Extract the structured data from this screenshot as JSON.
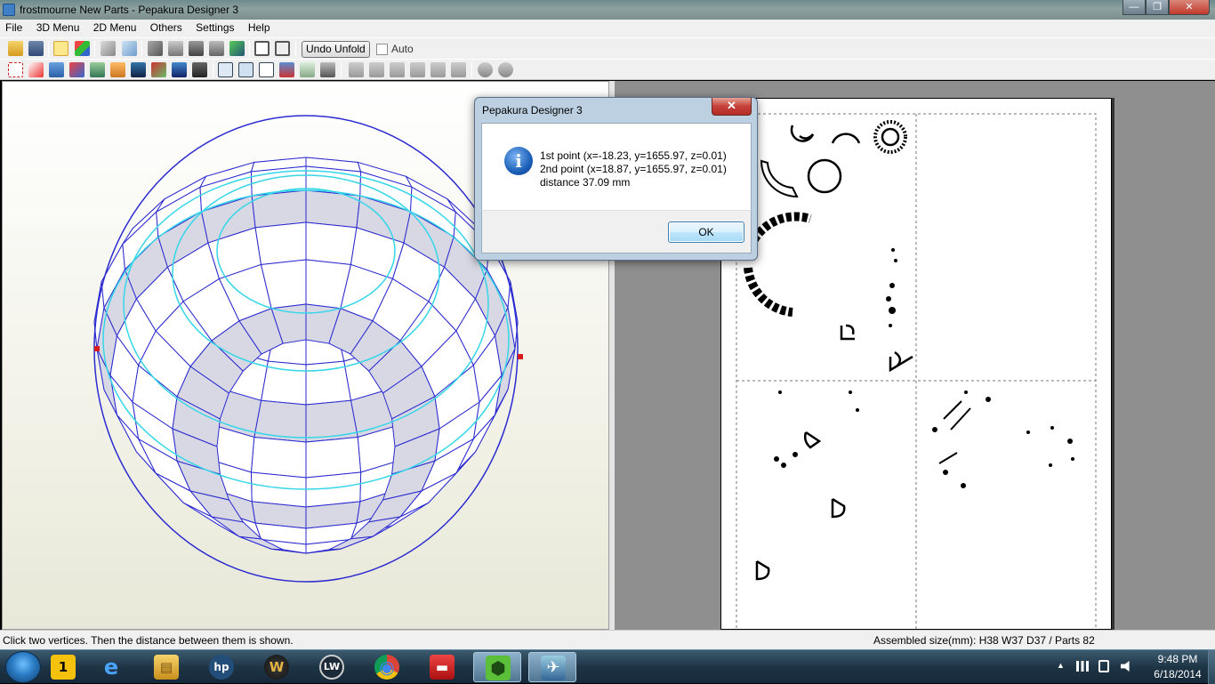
{
  "window": {
    "title": "frostmourne New Parts - Pepakura Designer 3",
    "min_glyph": "—",
    "max_glyph": "❐",
    "close_glyph": "✕"
  },
  "menu": [
    "File",
    "3D Menu",
    "2D Menu",
    "Others",
    "Settings",
    "Help"
  ],
  "toolbar": {
    "undo_unfold_label": "Undo Unfold",
    "auto_label": "Auto"
  },
  "status": {
    "left": "Click two vertices. Then the distance between them is shown.",
    "right": "Assembled size(mm): H38 W37 D37 / Parts 82"
  },
  "dialog": {
    "title": "Pepakura Designer 3",
    "close_glyph": "✕",
    "line1": "1st point (x=-18.23, y=1655.97, z=0.01)",
    "line2": "2nd point (x=18.87, y=1655.97, z=0.01)",
    "line3": "distance 37.09 mm",
    "ok_label": "OK",
    "icon_glyph": "i"
  },
  "taskbar": {
    "apps": [
      {
        "name": "1password",
        "glyph": "1"
      },
      {
        "name": "internet-explorer",
        "glyph": "e"
      },
      {
        "name": "file-explorer",
        "glyph": "▤"
      },
      {
        "name": "hp",
        "glyph": "hp"
      },
      {
        "name": "wow",
        "glyph": "W"
      },
      {
        "name": "lightwave",
        "glyph": "LW"
      },
      {
        "name": "chrome",
        "glyph": "◉"
      },
      {
        "name": "toolbox",
        "glyph": "▬"
      },
      {
        "name": "green-app",
        "glyph": "⬢"
      },
      {
        "name": "pepakura",
        "glyph": "✈"
      }
    ],
    "time": "9:48 PM",
    "date": "6/18/2014",
    "tray_up": "▲"
  },
  "colors": {
    "mesh_line": "#2b2bd0",
    "mesh_fill": "#ffffff",
    "mesh_shade": "#d8d8e4",
    "cyan_line": "#35d6e8",
    "vertex_marker": "#d81b1b"
  }
}
